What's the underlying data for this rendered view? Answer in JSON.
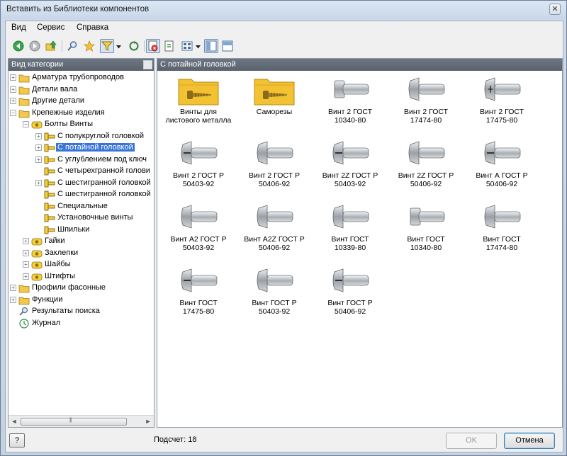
{
  "window": {
    "title": "Вставить из Библиотеки компонентов",
    "close_glyph": "✕"
  },
  "menu": [
    "Вид",
    "Сервис",
    "Справка"
  ],
  "toolbar": {
    "icons": [
      "back-icon",
      "forward-icon",
      "up-folder-icon",
      "search-icon",
      "favorites-star-icon",
      "filter-icon",
      "refresh-icon",
      "settings-icon",
      "update-icon",
      "view-mode-icon",
      "split-view-icon",
      "list-view-icon"
    ]
  },
  "left_panel": {
    "header": "Вид категории",
    "tree": [
      {
        "label": "Арматура трубопроводов",
        "level": 0,
        "expander": "+"
      },
      {
        "label": "Детали вала",
        "level": 0,
        "expander": "+"
      },
      {
        "label": "Другие детали",
        "level": 0,
        "expander": "+"
      },
      {
        "label": "Крепежные изделия",
        "level": 0,
        "expander": "−"
      },
      {
        "label": "Болты Винты",
        "level": 1,
        "expander": "−"
      },
      {
        "label": "С полукруглой головкой",
        "level": 2,
        "expander": "+"
      },
      {
        "label": "С потайной головкой",
        "level": 2,
        "expander": "+",
        "selected": true
      },
      {
        "label": "С углублением под ключ",
        "level": 2,
        "expander": "+"
      },
      {
        "label": "С четырехгранной голови",
        "level": 2,
        "expander": ""
      },
      {
        "label": "С шестигранной головкой",
        "level": 2,
        "expander": "+"
      },
      {
        "label": "С шестигранной головкой",
        "level": 2,
        "expander": ""
      },
      {
        "label": "Специальные",
        "level": 2,
        "expander": ""
      },
      {
        "label": "Установочные винты",
        "level": 2,
        "expander": ""
      },
      {
        "label": "Шпильки",
        "level": 2,
        "expander": ""
      },
      {
        "label": "Гайки",
        "level": 1,
        "expander": "+"
      },
      {
        "label": "Заклепки",
        "level": 1,
        "expander": "+"
      },
      {
        "label": "Шайбы",
        "level": 1,
        "expander": "+"
      },
      {
        "label": "Штифты",
        "level": 1,
        "expander": "+"
      },
      {
        "label": "Профили фасонные",
        "level": 0,
        "expander": "+"
      },
      {
        "label": "Функции",
        "level": 0,
        "expander": "+"
      },
      {
        "label": "Результаты поиска",
        "level": 0,
        "expander": ""
      },
      {
        "label": "Журнал",
        "level": 0,
        "expander": ""
      }
    ],
    "scroll_left": "◄",
    "scroll_right": "►",
    "scroll_grip": "|||"
  },
  "right_panel": {
    "header": "С потайной головкой",
    "items": [
      {
        "line1": "Винты для",
        "line2": "листового металла",
        "kind": "folder"
      },
      {
        "line1": "Саморезы",
        "line2": "",
        "kind": "folder"
      },
      {
        "line1": "Винт 2 ГОСТ",
        "line2": "10340-80",
        "kind": "screw-hex"
      },
      {
        "line1": "Винт 2 ГОСТ",
        "line2": "17474-80",
        "kind": "screw"
      },
      {
        "line1": "Винт 2 ГОСТ",
        "line2": "17475-80",
        "kind": "screw-cross"
      },
      {
        "line1": "Винт 2 ГОСТ Р",
        "line2": "50403-92",
        "kind": "screw-slot"
      },
      {
        "line1": "Винт 2 ГОСТ Р",
        "line2": "50406-92",
        "kind": "screw"
      },
      {
        "line1": "Винт 2Z ГОСТ Р",
        "line2": "50403-92",
        "kind": "screw-slot"
      },
      {
        "line1": "Винт 2Z ГОСТ Р",
        "line2": "50406-92",
        "kind": "screw"
      },
      {
        "line1": "Винт А ГОСТ Р",
        "line2": "50406-92",
        "kind": "screw-slot"
      },
      {
        "line1": "Винт А2 ГОСТ Р",
        "line2": "50403-92",
        "kind": "screw"
      },
      {
        "line1": "Винт А2Z ГОСТ Р",
        "line2": "50406-92",
        "kind": "screw"
      },
      {
        "line1": "Винт ГОСТ",
        "line2": "10339-80",
        "kind": "screw"
      },
      {
        "line1": "Винт ГОСТ",
        "line2": "10340-80",
        "kind": "screw-hex"
      },
      {
        "line1": "Винт ГОСТ",
        "line2": "17474-80",
        "kind": "screw"
      },
      {
        "line1": "Винт ГОСТ",
        "line2": "17475-80",
        "kind": "screw-slot"
      },
      {
        "line1": "Винт ГОСТ Р",
        "line2": "50403-92",
        "kind": "screw"
      },
      {
        "line1": "Винт ГОСТ Р",
        "line2": "50406-92",
        "kind": "screw-slot"
      }
    ]
  },
  "status": {
    "help_label": "?",
    "count_label": "Подсчет: 18",
    "ok_label": "OK",
    "cancel_label": "Отмена"
  }
}
